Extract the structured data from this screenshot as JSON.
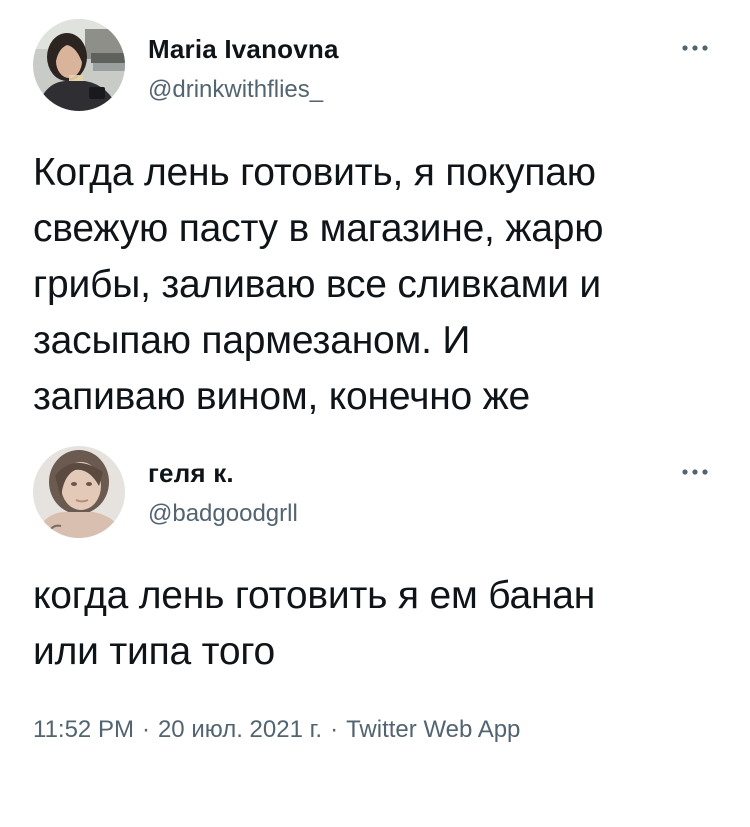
{
  "tweets": [
    {
      "display_name": "Maria Ivanovna",
      "handle": "@drinkwithflies_",
      "text": "Когда лень готовить, я покупаю\nсвежую пасту в магазине, жарю\nгрибы, заливаю все сливками и\nзасыпаю пармезаном. И\nзапиваю вином, конечно же",
      "more_icon": "more-horizontal-icon"
    },
    {
      "display_name": "геля к.",
      "handle": "@badgoodgrll",
      "text": "когда лень готовить я ем банан\nили типа того",
      "more_icon": "more-horizontal-icon"
    }
  ],
  "meta": {
    "time": "11:52 PM",
    "separator": "·",
    "date": "20 июл. 2021 г.",
    "source": "Twitter Web App"
  },
  "colors": {
    "text": "#0f1419",
    "secondary": "#536471",
    "background": "#ffffff"
  }
}
